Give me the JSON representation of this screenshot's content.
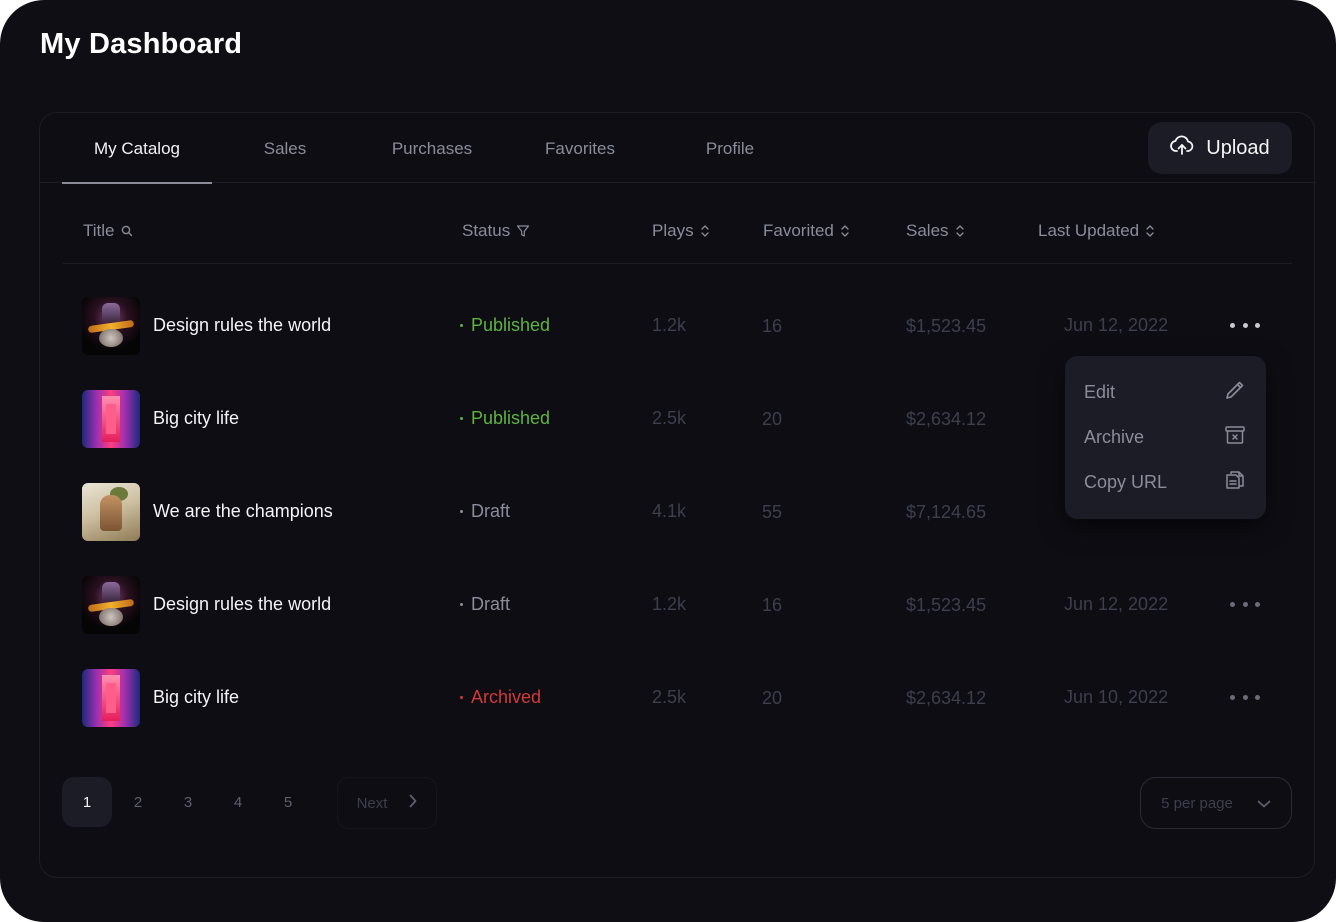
{
  "page": {
    "title": "My Dashboard"
  },
  "tabs": [
    {
      "label": "My Catalog",
      "active": true
    },
    {
      "label": "Sales",
      "active": false
    },
    {
      "label": "Purchases",
      "active": false
    },
    {
      "label": "Favorites",
      "active": false
    },
    {
      "label": "Profile",
      "active": false
    }
  ],
  "upload": {
    "label": "Upload",
    "icon": "cloud-upload-icon"
  },
  "columns": {
    "title": "Title",
    "status": "Status",
    "plays": "Plays",
    "favorited": "Favorited",
    "sales": "Sales",
    "last_updated": "Last Updated"
  },
  "rows": [
    {
      "title": "Design rules the world",
      "status": "Published",
      "status_color": "#5fb342",
      "plays": "1.2k",
      "favorited": "16",
      "sales": "$1,523.45",
      "updated": "Jun 12, 2022"
    },
    {
      "title": "Big city life",
      "status": "Published",
      "status_color": "#5fb342",
      "plays": "2.5k",
      "favorited": "20",
      "sales": "$2,634.12",
      "updated": ""
    },
    {
      "title": "We are the champions",
      "status": "Draft",
      "status_color": "#8b8c99",
      "plays": "4.1k",
      "favorited": "55",
      "sales": "$7,124.65",
      "updated": ""
    },
    {
      "title": "Design rules the world",
      "status": "Draft",
      "status_color": "#8b8c99",
      "plays": "1.2k",
      "favorited": "16",
      "sales": "$1,523.45",
      "updated": "Jun 12, 2022"
    },
    {
      "title": "Big city life",
      "status": "Archived",
      "status_color": "#d23a3a",
      "plays": "2.5k",
      "favorited": "20",
      "sales": "$2,634.12",
      "updated": "Jun 10, 2022"
    }
  ],
  "row_menu": {
    "items": [
      {
        "label": "Edit",
        "icon": "pencil-icon"
      },
      {
        "label": "Archive",
        "icon": "archive-box-icon"
      },
      {
        "label": "Copy URL",
        "icon": "copy-icon"
      }
    ]
  },
  "pagination": {
    "pages": [
      "1",
      "2",
      "3",
      "4",
      "5"
    ],
    "current": "1",
    "next_label": "Next",
    "per_page_label": "5 per page"
  },
  "colors": {
    "background": "#0e0e14",
    "published": "#5fb342",
    "archived": "#d23a3a",
    "muted": "#8b8c99"
  }
}
